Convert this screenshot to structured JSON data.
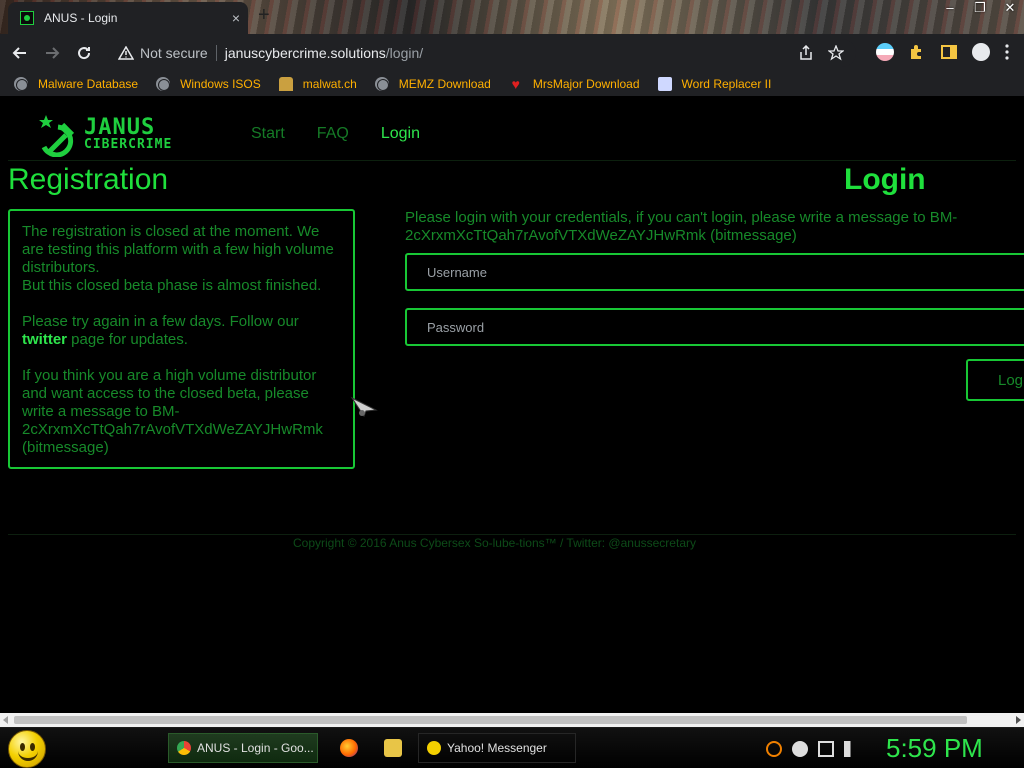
{
  "browser": {
    "tab_title": "ANUS - Login",
    "tab_close": "×",
    "new_tab": "+",
    "window_controls": [
      "–",
      "❐",
      "✕"
    ],
    "security_label": "Not secure",
    "url_host": "januscybercrime.solutions",
    "url_path": "/login/"
  },
  "bookmarks": [
    {
      "label": "Malware Database",
      "icon": "globe-icon"
    },
    {
      "label": "Windows ISOS",
      "icon": "globe-icon"
    },
    {
      "label": "malwat.ch",
      "icon": "person-icon"
    },
    {
      "label": "MEMZ Download",
      "icon": "globe-icon"
    },
    {
      "label": "MrsMajor Download",
      "icon": "heart-icon"
    },
    {
      "label": "Word Replacer II",
      "icon": "word-replacer-icon"
    }
  ],
  "site": {
    "logo_line1": "JANUS",
    "logo_line2": "CIBERCRIME",
    "nav": [
      {
        "label": "Start",
        "active": false
      },
      {
        "label": "FAQ",
        "active": false
      },
      {
        "label": "Login",
        "active": true
      }
    ],
    "registration": {
      "heading": "Registration",
      "p1": "The registration is closed at the moment. We are testing this platform with a few high volume distributors.",
      "p1b": "But this closed beta phase is almost finished.",
      "p2_before": "Please try again in a few days. Follow our ",
      "p2_link": "twitter",
      "p2_after": " page for updates.",
      "p3": "If you think you are a high volume distributor and want access to the closed beta, please write a message to BM-2cXrxmXcTtQah7rAvofVTXdWeZAYJHwRmk (bitmessage)"
    },
    "login": {
      "heading": "Login",
      "info": "Please login with your credentials, if you can't login, please write a message to BM-2cXrxmXcTtQah7rAvofVTXdWeZAYJHwRmk (bitmessage)",
      "username_placeholder": "Username",
      "password_placeholder": "Password",
      "button_label": "Log"
    },
    "footer": "Copyright © 2016 Anus Cybersex So-lube-tions™ / Twitter: @anussecretary"
  },
  "taskbar": {
    "chrome_task": "ANUS - Login - Goo...",
    "yahoo_task": "Yahoo! Messenger",
    "clock": "5:59 PM"
  },
  "colors": {
    "accent_green": "#1fe03c",
    "dim_green": "#178a2a",
    "bookmark_text": "#ffb000"
  }
}
